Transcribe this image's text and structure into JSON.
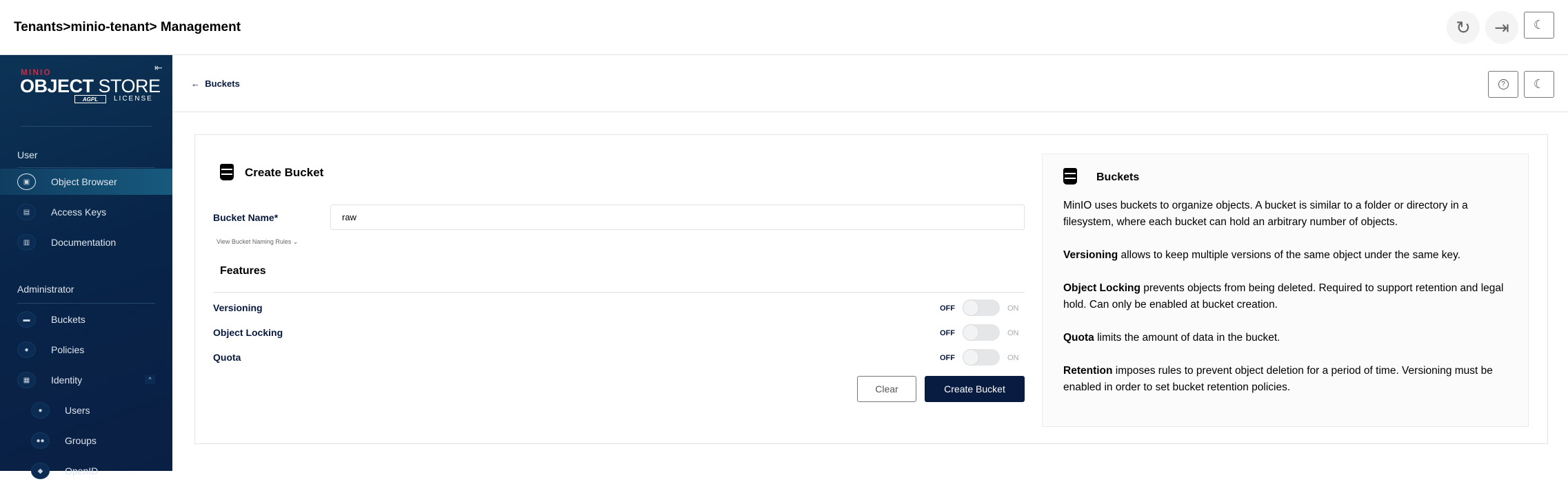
{
  "header": {
    "breadcrumb": "Tenants>minio-tenant> Management",
    "refresh_icon": "↻",
    "logout_icon": "⇥",
    "theme_icon": "☾"
  },
  "sidebar": {
    "logo": {
      "brand": "MINIO",
      "product_bold": "OBJECT",
      "product": " STORE",
      "badge": "AGPL",
      "license": "LICENSE"
    },
    "collapse_icon": "⇤",
    "user_section": "User",
    "user_items": [
      {
        "label": "Object Browser",
        "icon": "object-browser-icon",
        "selected": true
      },
      {
        "label": "Access Keys",
        "icon": "access-keys-icon"
      },
      {
        "label": "Documentation",
        "icon": "documentation-icon"
      }
    ],
    "admin_section": "Administrator",
    "admin_items": [
      {
        "label": "Buckets",
        "icon": "bucket-icon"
      },
      {
        "label": "Policies",
        "icon": "policy-icon"
      },
      {
        "label": "Identity",
        "icon": "identity-icon",
        "expanded": true
      }
    ],
    "identity_items": [
      {
        "label": "Users",
        "icon": "user-icon"
      },
      {
        "label": "Groups",
        "icon": "groups-icon"
      },
      {
        "label": "OpenID",
        "icon": "openid-icon"
      }
    ]
  },
  "subheader": {
    "back_label": "Buckets",
    "back_icon": "←",
    "help_icon": "?",
    "theme_icon": "☾"
  },
  "form": {
    "title": "Create Bucket",
    "bucket_name_label": "Bucket Name*",
    "bucket_name_value": "raw",
    "naming_rules_link": "View Bucket Naming Rules ⌄",
    "features_title": "Features",
    "features": [
      {
        "label": "Versioning",
        "off": "OFF",
        "on": "ON",
        "enabled": false
      },
      {
        "label": "Object Locking",
        "off": "OFF",
        "on": "ON",
        "enabled": false
      },
      {
        "label": "Quota",
        "off": "OFF",
        "on": "ON",
        "enabled": false
      }
    ],
    "clear_label": "Clear",
    "create_label": "Create Bucket",
    "accent": "#081c42"
  },
  "help": {
    "title": "Buckets",
    "intro": "MinIO uses buckets to organize objects. A bucket is similar to a folder or directory in a filesystem, where each bucket can hold an arbitrary number of objects.",
    "items": [
      {
        "term": "Versioning",
        "text": " allows to keep multiple versions of the same object under the same key."
      },
      {
        "term": "Object Locking",
        "text": " prevents objects from being deleted. Required to support retention and legal hold. Can only be enabled at bucket creation."
      },
      {
        "term": "Quota",
        "text": " limits the amount of data in the bucket."
      },
      {
        "term": "Retention",
        "text": " imposes rules to prevent object deletion for a period of time. Versioning must be enabled in order to set bucket retention policies."
      }
    ]
  }
}
